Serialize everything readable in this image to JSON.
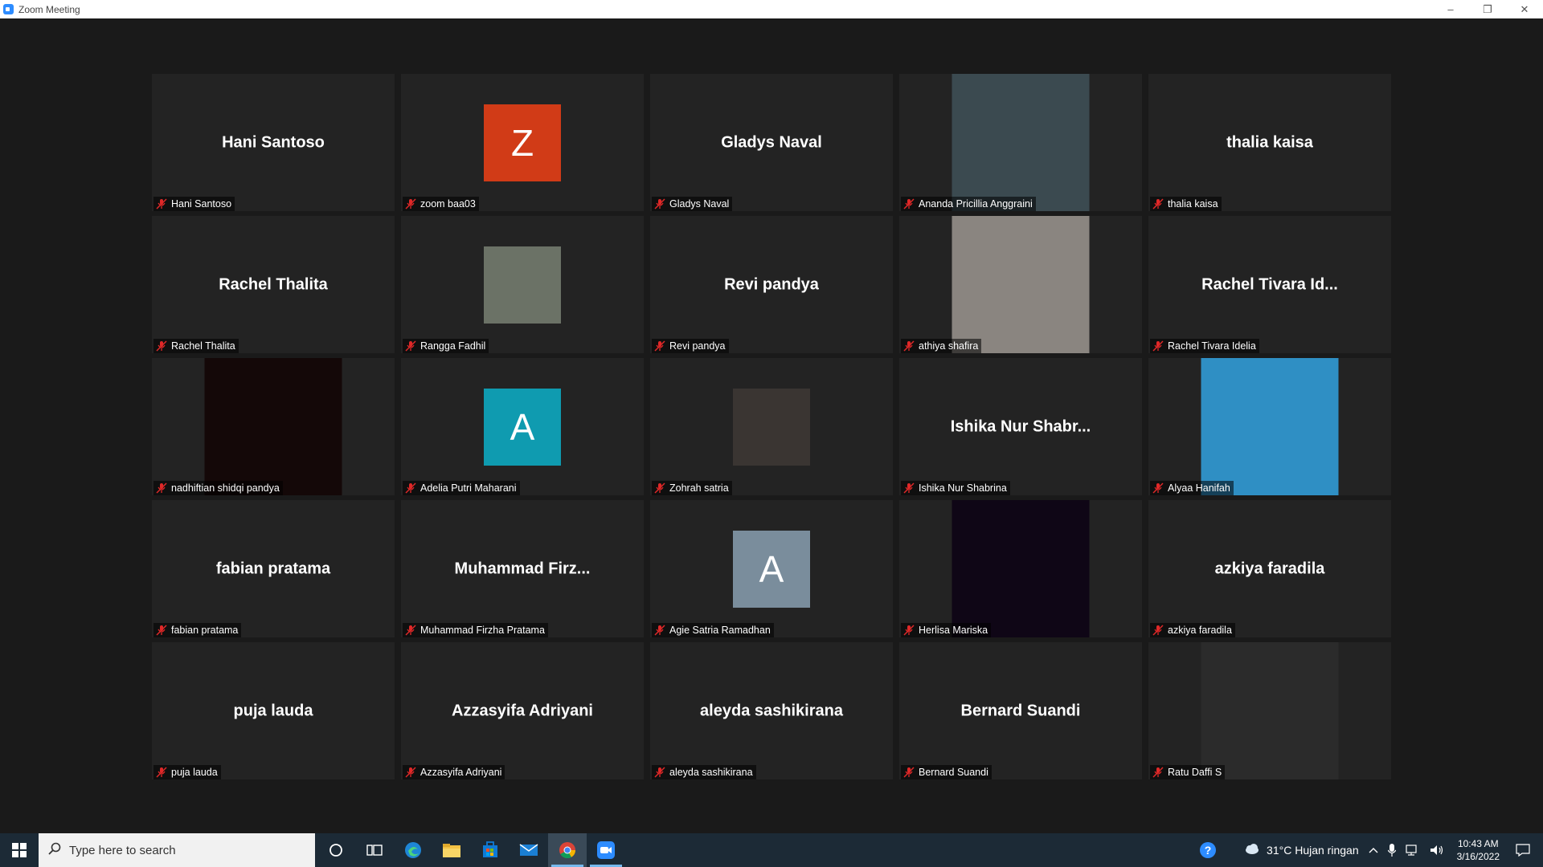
{
  "window": {
    "title": "Zoom Meeting",
    "controls": [
      "–",
      "❐",
      "✕"
    ]
  },
  "participants": [
    {
      "display_name": "Hani Santoso",
      "label": "Hani Santoso",
      "mode": "name"
    },
    {
      "display_name": "Z",
      "label": "zoom baa03",
      "mode": "avatar",
      "color": "#d13b17"
    },
    {
      "display_name": "Gladys Naval",
      "label": "Gladys Naval",
      "mode": "name"
    },
    {
      "display_name": "",
      "label": "Ananda Pricillia Anggraini",
      "mode": "video",
      "color": "#3b4a50"
    },
    {
      "display_name": "thalia kaisa",
      "label": "thalia kaisa",
      "mode": "name"
    },
    {
      "display_name": "Rachel Thalita",
      "label": "Rachel Thalita",
      "mode": "name"
    },
    {
      "display_name": "",
      "label": "Rangga Fadhil",
      "mode": "thumb",
      "color": "#6b7266"
    },
    {
      "display_name": "Revi pandya",
      "label": "Revi pandya",
      "mode": "name"
    },
    {
      "display_name": "",
      "label": "athiya shafira",
      "mode": "video",
      "color": "#8a8580"
    },
    {
      "display_name": "Rachel Tivara Id...",
      "label": "Rachel Tivara Idelia",
      "mode": "name"
    },
    {
      "display_name": "",
      "label": "nadhiftian shidqi pandya",
      "mode": "video",
      "color": "#140808"
    },
    {
      "display_name": "A",
      "label": "Adelia Putri Maharani",
      "mode": "avatar",
      "color": "#0f9bb0"
    },
    {
      "display_name": "",
      "label": "Zohrah satria",
      "mode": "thumb",
      "color": "#3a3532"
    },
    {
      "display_name": "Ishika Nur Shabr...",
      "label": "Ishika Nur Shabrina",
      "mode": "name"
    },
    {
      "display_name": "",
      "label": "Alyaa Hanifah",
      "mode": "video",
      "color": "#2f8fc4"
    },
    {
      "display_name": "fabian pratama",
      "label": "fabian pratama",
      "mode": "name"
    },
    {
      "display_name": "Muhammad  Firz...",
      "label": "Muhammad Firzha Pratama",
      "mode": "name"
    },
    {
      "display_name": "A",
      "label": "Agie Satria Ramadhan",
      "mode": "avatar",
      "color": "#7a8d9c"
    },
    {
      "display_name": "",
      "label": "Herlisa Mariska",
      "mode": "video",
      "color": "#0f0616"
    },
    {
      "display_name": "azkiya faradila",
      "label": "azkiya faradila",
      "mode": "name"
    },
    {
      "display_name": "puja lauda",
      "label": "puja lauda",
      "mode": "name"
    },
    {
      "display_name": "Azzasyifa Adriyani",
      "label": "Azzasyifa Adriyani",
      "mode": "name"
    },
    {
      "display_name": "aleyda sashikirana",
      "label": "aleyda sashikirana",
      "mode": "name"
    },
    {
      "display_name": "Bernard Suandi",
      "label": "Bernard Suandi",
      "mode": "name"
    },
    {
      "display_name": "",
      "label": "Ratu Daffi S",
      "mode": "video",
      "color": "#2b2b2b"
    }
  ],
  "taskbar": {
    "search_placeholder": "Type here to search",
    "weather": "31°C  Hujan ringan",
    "time": "10:43 AM",
    "date": "3/16/2022"
  }
}
